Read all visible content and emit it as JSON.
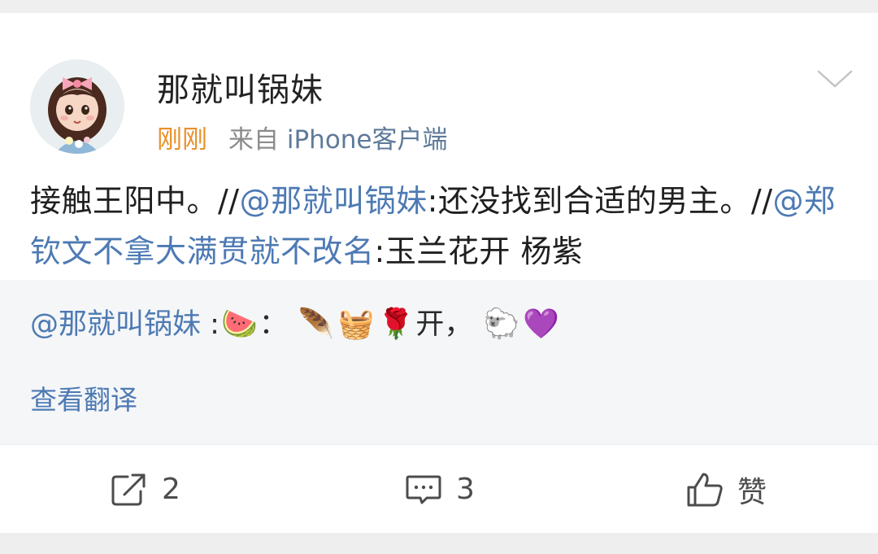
{
  "post": {
    "username": "那就叫锅妹",
    "time": "刚刚",
    "source": "来自",
    "source_app": "iPhone客户端",
    "text_parts": [
      {
        "type": "text",
        "value": "接触王阳中。//"
      },
      {
        "type": "mention",
        "value": "@那就叫锅妹"
      },
      {
        "type": "text",
        "value": ":还没找到合适的男主。//"
      },
      {
        "type": "mention",
        "value": "@郑钦文不拿大满贯就不改名"
      },
      {
        "type": "text",
        "value": ":玉兰花开 杨紫"
      }
    ]
  },
  "quoted": {
    "mention": "@那就叫锅妹",
    "colon1": " :",
    "emoji1": "🍉",
    "colon2": "：",
    "emoji2": "🪶",
    "emoji3": "🧺",
    "emoji4": "🌹",
    "text1": "开，",
    "emoji5": "🐑",
    "emoji6": "💜",
    "translate_label": "查看翻译"
  },
  "actions": {
    "repost_count": "2",
    "comment_count": "3",
    "like_label": "赞"
  },
  "icons": {
    "chevron": "chevron-down-icon",
    "repost": "share-icon",
    "comment": "comment-icon",
    "like": "thumbs-up-icon"
  },
  "colors": {
    "mention": "#4d7ab3",
    "time": "#e8902b"
  }
}
